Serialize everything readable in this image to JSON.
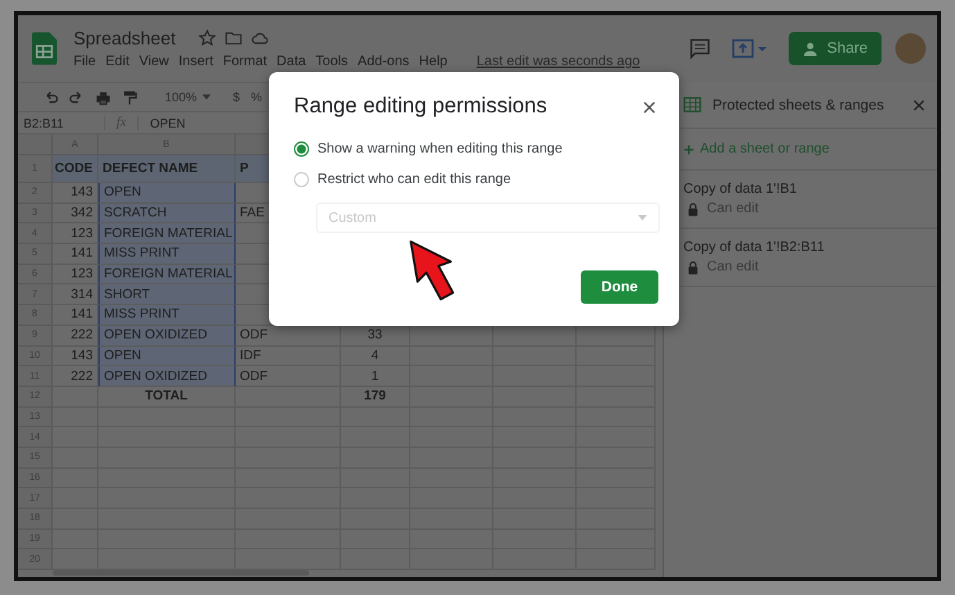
{
  "app": {
    "title": "Spreadsheet",
    "menu": [
      "File",
      "Edit",
      "View",
      "Insert",
      "Format",
      "Data",
      "Tools",
      "Add-ons",
      "Help"
    ],
    "last_edit": "Last edit was seconds ago",
    "share_button": "Share"
  },
  "toolbar": {
    "zoom": "100%",
    "currency": "$",
    "percent": "%"
  },
  "formula_bar": {
    "cell_ref": "B2:B11",
    "fx_label": "fx",
    "value": "OPEN"
  },
  "sheet": {
    "columns": [
      "A",
      "B"
    ],
    "rows": [
      {
        "number": "1",
        "kind": "header",
        "selected": false,
        "cells": [
          "CODE",
          "DEFECT NAME",
          "P",
          ""
        ]
      },
      {
        "number": "2",
        "kind": "data",
        "selected": true,
        "cells": [
          "143",
          "OPEN",
          "",
          ""
        ]
      },
      {
        "number": "3",
        "kind": "data",
        "selected": true,
        "cells": [
          "342",
          "SCRATCH",
          "FAE",
          ""
        ]
      },
      {
        "number": "4",
        "kind": "data",
        "selected": true,
        "cells": [
          "123",
          "FOREIGN MATERIAL",
          "",
          ""
        ]
      },
      {
        "number": "5",
        "kind": "data",
        "selected": true,
        "cells": [
          "141",
          "MISS PRINT",
          "",
          ""
        ]
      },
      {
        "number": "6",
        "kind": "data",
        "selected": true,
        "cells": [
          "123",
          "FOREIGN MATERIAL",
          "",
          ""
        ]
      },
      {
        "number": "7",
        "kind": "data",
        "selected": true,
        "cells": [
          "314",
          "SHORT",
          "",
          ""
        ]
      },
      {
        "number": "8",
        "kind": "data",
        "selected": true,
        "cells": [
          "141",
          "MISS PRINT",
          "",
          ""
        ]
      },
      {
        "number": "9",
        "kind": "data",
        "selected": true,
        "cells": [
          "222",
          "OPEN OXIDIZED",
          "ODF",
          "33"
        ]
      },
      {
        "number": "10",
        "kind": "data",
        "selected": true,
        "cells": [
          "143",
          "OPEN",
          "IDF",
          "4"
        ]
      },
      {
        "number": "11",
        "kind": "data",
        "selected": true,
        "cells": [
          "222",
          "OPEN OXIDIZED",
          "ODF",
          "1"
        ]
      },
      {
        "number": "12",
        "kind": "total",
        "selected": false,
        "cells": [
          "",
          "TOTAL",
          "",
          "179"
        ]
      },
      {
        "number": "13",
        "kind": "empty",
        "selected": false,
        "cells": []
      },
      {
        "number": "14",
        "kind": "empty",
        "selected": false,
        "cells": []
      },
      {
        "number": "15",
        "kind": "empty",
        "selected": false,
        "cells": []
      },
      {
        "number": "16",
        "kind": "empty",
        "selected": false,
        "cells": []
      },
      {
        "number": "17",
        "kind": "empty",
        "selected": false,
        "cells": []
      },
      {
        "number": "18",
        "kind": "empty",
        "selected": false,
        "cells": []
      },
      {
        "number": "19",
        "kind": "empty",
        "selected": false,
        "cells": []
      },
      {
        "number": "20",
        "kind": "empty",
        "selected": false,
        "cells": []
      }
    ]
  },
  "dialog": {
    "title": "Range editing permissions",
    "options": [
      {
        "label": "Show a warning when editing this range",
        "selected": true
      },
      {
        "label": "Restrict who can edit this range",
        "selected": false
      }
    ],
    "dropdown": {
      "value": "Custom",
      "disabled": true
    },
    "done_button": "Done"
  },
  "panel": {
    "title": "Protected sheets & ranges",
    "add_link": "Add a sheet or range",
    "ranges": [
      {
        "name": "Copy of data 1'!B1",
        "permission": "Can edit"
      },
      {
        "name": "Copy of data 1'!B2:B11",
        "permission": "Can edit"
      }
    ]
  }
}
